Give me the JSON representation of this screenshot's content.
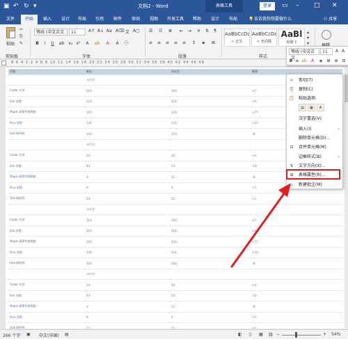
{
  "titlebar": {
    "qa_save_icon": "save-icon",
    "qa_undo_icon": "undo-icon",
    "qa_redo_icon": "redo-icon",
    "qa_more_icon": "more-icon",
    "doc_title": "文档2 - Word",
    "context_tools": "表格工具",
    "login": "登录"
  },
  "tabs": [
    {
      "label": "文件"
    },
    {
      "label": "开始",
      "active": true
    },
    {
      "label": "插入"
    },
    {
      "label": "设计"
    },
    {
      "label": "布局"
    },
    {
      "label": "引用"
    },
    {
      "label": "邮件"
    },
    {
      "label": "审阅"
    },
    {
      "label": "视图"
    },
    {
      "label": "开发工具"
    },
    {
      "label": "帮助"
    },
    {
      "label": "设计"
    },
    {
      "label": "布局"
    }
  ],
  "tellme": "告诉我你想要做什么",
  "share": "共享",
  "ribbon": {
    "paste_label": "粘贴",
    "clipboard_group": "剪贴板",
    "font_name": "等线 (中文正文",
    "font_size": "11",
    "font_group": "字体",
    "para_group": "段落",
    "styles": [
      {
        "sample": "AaBbCcDc",
        "name": "↵ 正文"
      },
      {
        "sample": "AaBbCcDc",
        "name": "↵ 无间隔"
      },
      {
        "sample": "AaBl",
        "name": "标题 1"
      }
    ],
    "styles_group": "样式",
    "edit_label": "编辑"
  },
  "ruler_numbers": "8  6  4  2     2  4  6  8  10  12  14  16  18  20  22  24  26  28  30  32  34  36  38  40  42  44  46  48",
  "table": {
    "headers": [
      "学院:",
      "新生:",
      "毕业生:",
      "更改:"
    ],
    "rows": [
      [
        "",
        "本科生:",
        "",
        ""
      ],
      [
        "Cedar 大学:",
        "110:",
        "103:",
        "+7:"
      ],
      [
        "Elm 学院:",
        "223:",
        "214:",
        "+9:"
      ],
      [
        "Maple 高等专科院校:",
        "197:",
        "120:",
        "+77:"
      ],
      [
        "Pine 学院:",
        "134:",
        "121:",
        "+13:"
      ],
      [
        "Oak 研究所:",
        "202:",
        "210:",
        "-8:"
      ],
      [
        "",
        "研究生:",
        "",
        ""
      ],
      [
        "Cedar 大学:",
        "24:",
        "20:",
        "+4:"
      ],
      [
        "Elm 学院:",
        "43:",
        "53:",
        "-10:"
      ],
      [
        "Maple 高等专科院校:",
        "3:",
        "11:",
        "-8:"
      ],
      [
        "Pine 学院:",
        "9:",
        "4:",
        "+5:"
      ],
      [
        "Oak 研究所:",
        "53:",
        "52:",
        "+1:"
      ],
      [
        "",
        "本科生:",
        "",
        ""
      ],
      [
        "Cedar 大学:",
        "110:",
        "103:",
        "+7:"
      ],
      [
        "Elm 学院:",
        "223:",
        "214:",
        "+9:"
      ],
      [
        "Maple 高等专科院校:",
        "197:",
        "120:",
        "+77:"
      ],
      [
        "Pine 学院:",
        "134:",
        "121:",
        "+13:"
      ],
      [
        "Oak 研究所:",
        "202:",
        "210:",
        "-8:"
      ],
      [
        "",
        "研究生:",
        "",
        ""
      ],
      [
        "Cedar 大学:",
        "24:",
        "20:",
        "+4:"
      ],
      [
        "Elm 学院:",
        "43:",
        "53:",
        "-10:"
      ],
      [
        "Maple 高等专科院校:",
        "3:",
        "11:",
        "-8:"
      ],
      [
        "Pine 学院:",
        "9:",
        "4:",
        "+5:"
      ],
      [
        "Oak 研究所:",
        "53:",
        "52:",
        "+1:"
      ]
    ]
  },
  "mini_toolbar": {
    "font_name": "等线 (中文正文",
    "font_size": "11"
  },
  "context_menu": {
    "items": [
      {
        "label": "剪切(T)",
        "icon": "scissors-icon"
      },
      {
        "label": "复制(C)",
        "icon": "copy-icon"
      },
      {
        "label": "粘贴选项:",
        "icon": "paste-icon"
      },
      {
        "label": "汉字重选(V)",
        "icon": ""
      },
      {
        "label": "插入(I)",
        "icon": "",
        "submenu": true
      },
      {
        "label": "删除单元格(D)...",
        "icon": ""
      },
      {
        "label": "合并单元格(M)",
        "icon": "merge-cells-icon"
      },
      {
        "label": "边框样式(B)",
        "icon": "",
        "submenu": true
      },
      {
        "label": "文字方向(X)...",
        "icon": "text-direction-icon"
      },
      {
        "label": "表格属性(R)...",
        "icon": "table-properties-icon"
      },
      {
        "label": "新建批注(M)",
        "icon": "new-comment-icon"
      }
    ]
  },
  "status": {
    "word_count": "266 个字",
    "language": "中文(中国)",
    "zoom": "54%"
  },
  "accent": "#2b579a",
  "highlight_color": "#e31b1b"
}
